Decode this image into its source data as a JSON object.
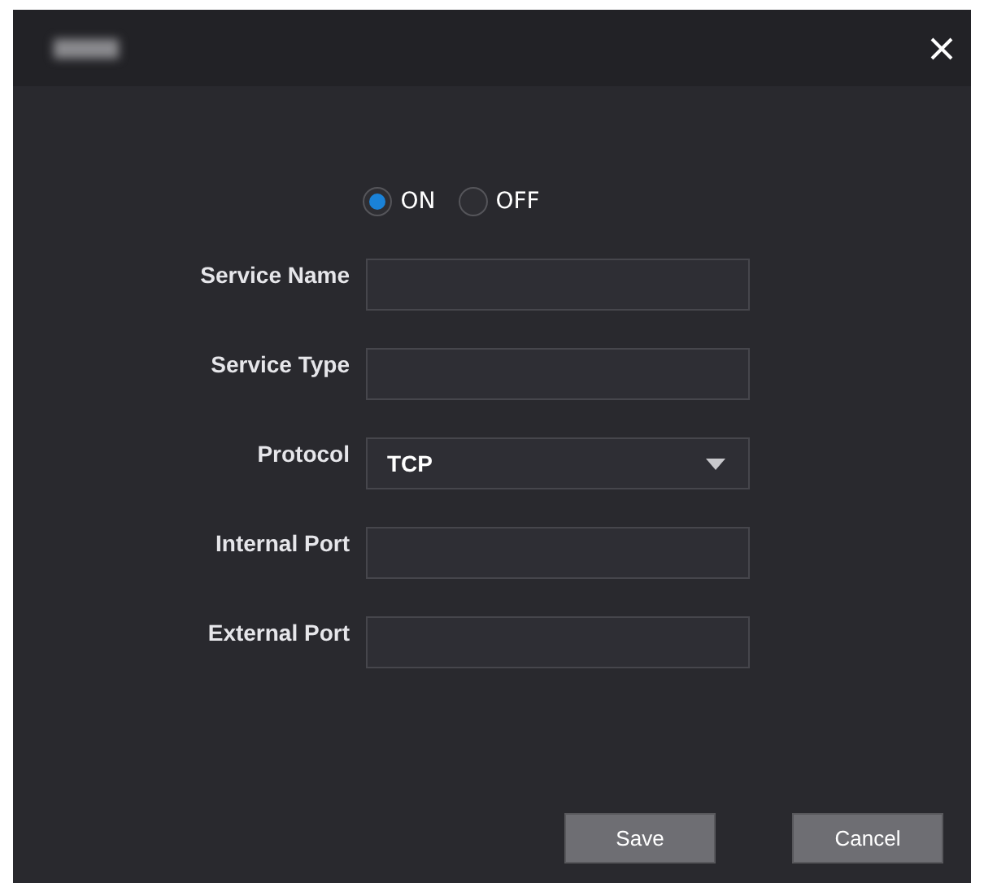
{
  "radios": [
    {
      "label": "ON",
      "selected": true
    },
    {
      "label": "OFF",
      "selected": false
    }
  ],
  "fields": [
    {
      "label": "Service Name",
      "kind": "text"
    },
    {
      "label": "Service Type",
      "kind": "text"
    },
    {
      "label": "Protocol",
      "kind": "select",
      "value": "TCP"
    },
    {
      "label": "Internal Port",
      "kind": "text"
    },
    {
      "label": "External Port",
      "kind": "text"
    }
  ],
  "buttons": [
    "Save",
    "Cancel"
  ]
}
